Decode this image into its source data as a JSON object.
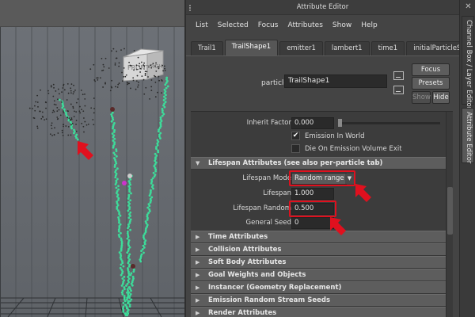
{
  "viewport": {
    "view_cube": {
      "front": "FRONT",
      "right": "RGH"
    }
  },
  "attribute_editor": {
    "title": "Attribute Editor",
    "menus": [
      "List",
      "Selected",
      "Focus",
      "Attributes",
      "Show",
      "Help"
    ],
    "tabs": [
      "Trail1",
      "TrailShape1",
      "emitter1",
      "lambert1",
      "time1",
      "initialParticleSE"
    ],
    "active_tab": "TrailShape1",
    "node_label": "particle:",
    "node_value": "TrailShape1",
    "buttons": {
      "focus": "Focus",
      "presets": "Presets",
      "show": "Show",
      "hide": "Hide"
    },
    "rows": {
      "inherit_factor": {
        "label": "Inherit Factor",
        "value": "0.000"
      },
      "emission_in_world": {
        "label": "Emission In World",
        "checked": true
      },
      "die_on_emission": {
        "label": "Die On Emission Volume Exit",
        "checked": false
      }
    },
    "lifespan_section": "Lifespan Attributes (see also per-particle tab)",
    "lifespan": {
      "mode_label": "Lifespan Mode",
      "mode_value": "Random range",
      "lifespan_label": "Lifespan",
      "lifespan_value": "1.000",
      "random_label": "Lifespan Random",
      "random_value": "0.500",
      "seed_label": "General Seed",
      "seed_value": "0"
    },
    "collapsed_sections": [
      "Time Attributes",
      "Collision Attributes",
      "Soft Body Attributes",
      "Goal Weights and Objects",
      "Instancer (Geometry Replacement)",
      "Emission Random Stream Seeds",
      "Render Attributes"
    ]
  },
  "side_tabs": {
    "channel_box": "Channel Box / Layer Editor",
    "attribute_editor": "Attribute Editor"
  },
  "colors": {
    "highlight": "#e0101e",
    "particle_trail": "#3ddc9a",
    "panel_bg": "#444444"
  },
  "icons": {
    "close": "close-icon",
    "collapsed": "triangle-right-icon",
    "expanded": "triangle-down-icon",
    "dropdown": "dropdown-arrow-icon"
  }
}
